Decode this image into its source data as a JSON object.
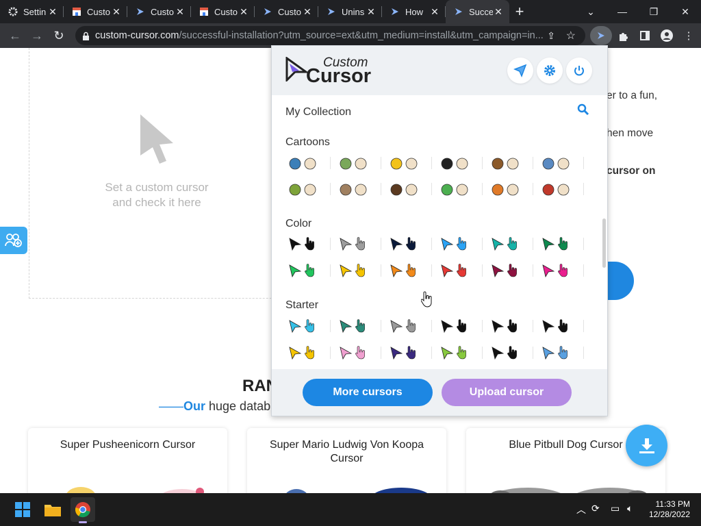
{
  "browser": {
    "tabs": [
      {
        "title": "Settin",
        "icon": "gear-icon",
        "active": false
      },
      {
        "title": "Custo",
        "icon": "store-icon",
        "active": false
      },
      {
        "title": "Custo",
        "icon": "cursor-icon",
        "active": false
      },
      {
        "title": "Custo",
        "icon": "store-icon",
        "active": false
      },
      {
        "title": "Custo",
        "icon": "cursor-icon",
        "active": false
      },
      {
        "title": "Unins",
        "icon": "cursor-icon",
        "active": false
      },
      {
        "title": "How",
        "icon": "cursor-icon",
        "active": false
      },
      {
        "title": "Succe",
        "icon": "cursor-icon",
        "active": true
      }
    ],
    "close_glyph": "✕",
    "new_tab": "+",
    "url_host": "custom-cursor.com",
    "url_path": "/successful-installation?utm_source=ext&utm_medium=install&utm_campaign=in..."
  },
  "page": {
    "preview_text_1": "Set a custom cursor",
    "preview_text_2": "and check it here",
    "side_text_1": "er to a fun,",
    "side_text_2": "hen move",
    "side_text_3": "cursor on",
    "random_heading": "RAN",
    "huge_dash": "——",
    "huge_our": "Our",
    "huge_rest": " huge databa",
    "cards": [
      {
        "title": "Super Pusheenicorn Cursor"
      },
      {
        "title": "Super Mario Ludwig Von Koopa Cursor"
      },
      {
        "title": "Blue Pitbull Dog Cursor"
      }
    ]
  },
  "popup": {
    "logo_word1": "Custom",
    "logo_word2": "Cursor",
    "my_collection": "My Collection",
    "sections": [
      {
        "title": "Cartoons"
      },
      {
        "title": "Color"
      },
      {
        "title": "Starter"
      }
    ],
    "more_cursors": "More cursors",
    "upload_cursor": "Upload cursor",
    "colors": {
      "more_btn": "#1d87e3",
      "upload_btn": "#b48be3",
      "color_pairs_row1": [
        "#111111",
        "#9e9e9e",
        "#0b1a3a",
        "#2ba3f5",
        "#17b3a8",
        "#0f8a4f"
      ],
      "color_pairs_row2": [
        "#22c55e",
        "#f5c400",
        "#f28a1a",
        "#e53935",
        "#8e1240",
        "#ea1f8f"
      ],
      "cartoon_row1": [
        "#3c7fb8",
        "#7aa85a",
        "#f2c21b",
        "#222222",
        "#8b5a2b",
        "#5a8ac2"
      ],
      "cartoon_row2": [
        "#7ea33a",
        "#a08060",
        "#5b3a20",
        "#4caf50",
        "#e07a28",
        "#c0392b"
      ],
      "starter_row1": [
        "#36c1e8",
        "#2b8c7a",
        "#9a9a9a",
        "#111111",
        "#111111",
        "#111111"
      ],
      "starter_row2": [
        "#f5c400",
        "#f0a0d0",
        "#3b2a80",
        "#88c93f",
        "#111111",
        "#5aa0e0"
      ]
    }
  },
  "taskbar": {
    "time": "11:33 PM",
    "date": "12/28/2022"
  }
}
